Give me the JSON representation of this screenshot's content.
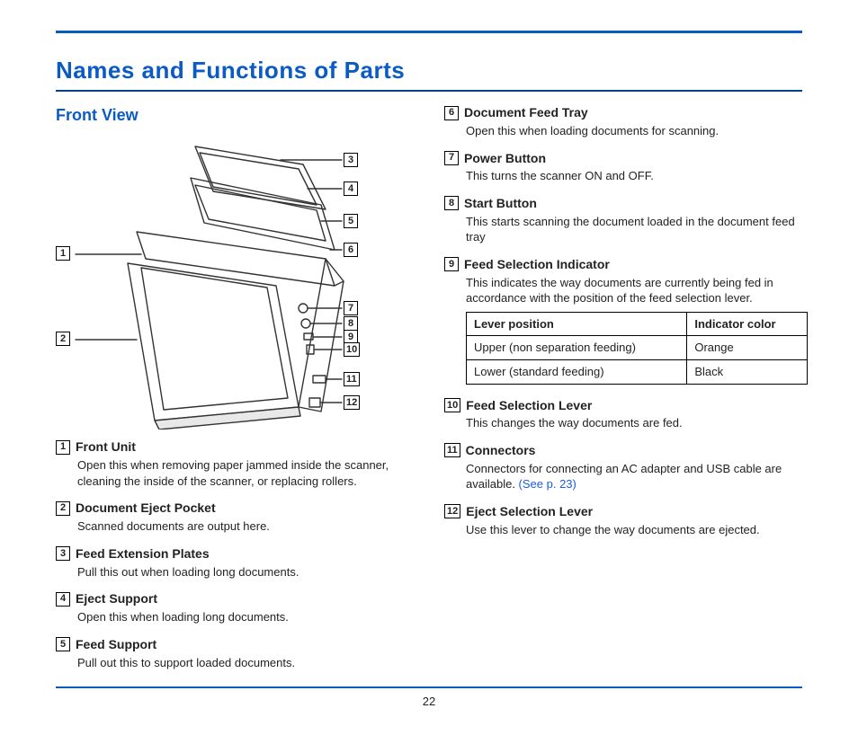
{
  "page_number": "22",
  "main_title": "Names and Functions of Parts",
  "section_title": "Front View",
  "see_link_text": "(See p. 23)",
  "callouts_left": [
    {
      "n": "1"
    },
    {
      "n": "2"
    }
  ],
  "callouts_right": [
    {
      "n": "3"
    },
    {
      "n": "4"
    },
    {
      "n": "5"
    },
    {
      "n": "6"
    },
    {
      "n": "7"
    },
    {
      "n": "8"
    },
    {
      "n": "9"
    },
    {
      "n": "10"
    },
    {
      "n": "11"
    },
    {
      "n": "12"
    }
  ],
  "indicator_table": {
    "header_pos": "Lever position",
    "header_color": "Indicator color",
    "rows": [
      {
        "pos": "Upper (non separation feeding)",
        "color": "Orange"
      },
      {
        "pos": "Lower (standard feeding)",
        "color": "Black"
      }
    ]
  },
  "parts_left": [
    {
      "n": "1",
      "title": "Front Unit",
      "desc": "Open this when removing paper jammed inside the scanner, cleaning the inside of the scanner, or replacing rollers."
    },
    {
      "n": "2",
      "title": "Document Eject Pocket",
      "desc": "Scanned documents are output here."
    },
    {
      "n": "3",
      "title": "Feed Extension Plates",
      "desc": "Pull this out when loading long documents."
    },
    {
      "n": "4",
      "title": "Eject Support",
      "desc": "Open this when loading long documents."
    },
    {
      "n": "5",
      "title": "Feed Support",
      "desc": "Pull out this to support loaded documents."
    }
  ],
  "parts_right": [
    {
      "n": "6",
      "title": "Document Feed Tray",
      "desc": "Open this when loading documents for scanning."
    },
    {
      "n": "7",
      "title": "Power Button",
      "desc": "This turns the scanner ON and OFF."
    },
    {
      "n": "8",
      "title": "Start Button",
      "desc": "This starts scanning the document loaded in the document feed tray"
    },
    {
      "n": "9",
      "title": "Feed Selection Indicator",
      "desc": "This indicates the way documents are currently being fed in accordance with the position of the feed selection lever.",
      "has_table": true
    },
    {
      "n": "10",
      "title": "Feed Selection Lever",
      "desc": "This changes the way documents are fed."
    },
    {
      "n": "11",
      "title": "Connectors",
      "desc": "Connectors for connecting an AC adapter and USB cable are available.",
      "has_link": true
    },
    {
      "n": "12",
      "title": "Eject Selection Lever",
      "desc": "Use this lever to change the way documents are ejected."
    }
  ]
}
